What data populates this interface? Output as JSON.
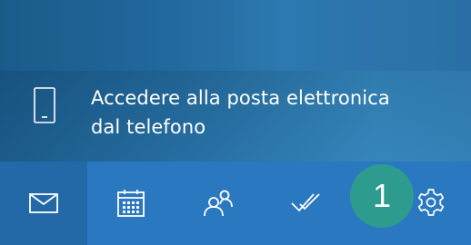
{
  "promo": {
    "icon": "mobile-phone-icon",
    "line1": "Accedere alla posta elettronica",
    "line2": "dal telefono"
  },
  "nav": {
    "items": [
      {
        "icon": "mail-icon"
      },
      {
        "icon": "calendar-icon"
      },
      {
        "icon": "people-icon"
      },
      {
        "icon": "todo-check-icon"
      },
      {
        "icon": "gear-icon"
      }
    ]
  },
  "callout": {
    "number": "1",
    "color": "#2e9b8f"
  },
  "colors": {
    "nav_background": "#2a78c0",
    "nav_selected": "#2369a8",
    "text": "#ffffff"
  }
}
